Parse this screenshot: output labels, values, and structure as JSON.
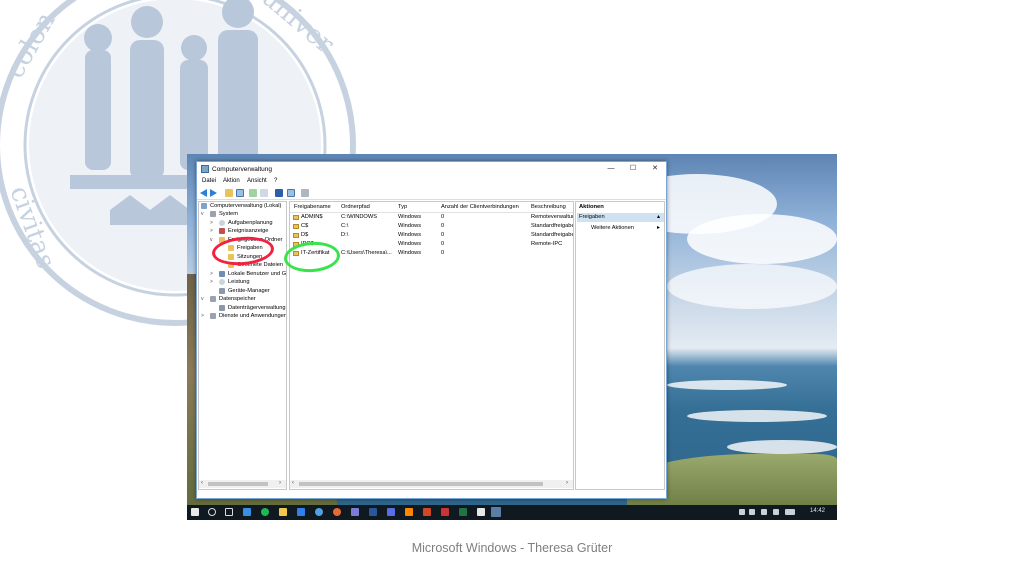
{
  "slide": {
    "caption": "Microsoft Windows - Theresa Grüter"
  },
  "window": {
    "title": "Computerverwaltung",
    "controls": {
      "minimize": "—",
      "maximize": "☐",
      "close": "✕"
    }
  },
  "menu": [
    "Datei",
    "Aktion",
    "Ansicht",
    "?"
  ],
  "tree": {
    "root": "Computerverwaltung (Lokal)",
    "system": "System",
    "aufgaben": "Aufgabenplanung",
    "ereignis": "Ereignisanzeige",
    "freigegebene": "Freigegebene Ordner",
    "freigaben": "Freigaben",
    "sitzungen": "Sitzungen",
    "geoeffnete": "Geöffnete Dateien",
    "lokale": "Lokale Benutzer und Gr",
    "leistung": "Leistung",
    "geraete": "Geräte-Manager",
    "datenspeicher": "Datenspeicher",
    "datentraeger": "Datenträgerverwaltung",
    "dienste": "Dienste und Anwendungen"
  },
  "table": {
    "columns": [
      "Freigabename",
      "Ordnerpfad",
      "Typ",
      "Anzahl der Clientverbindungen",
      "Beschreibung"
    ],
    "rows": [
      [
        "ADMIN$",
        "C:\\WINDOWS",
        "Windows",
        "0",
        "Remoteverwaltung"
      ],
      [
        "C$",
        "C:\\",
        "Windows",
        "0",
        "Standardfreigabe"
      ],
      [
        "D$",
        "D:\\",
        "Windows",
        "0",
        "Standardfreigabe"
      ],
      [
        "IPC$",
        "",
        "Windows",
        "0",
        "Remote-IPC"
      ],
      [
        "IT-Zertifikat",
        "C:\\Users\\Theresa\\...",
        "Windows",
        "0",
        ""
      ]
    ]
  },
  "actions": {
    "header": "Aktionen",
    "section": "Freigaben",
    "more": "Weitere Aktionen"
  },
  "taskbar": {
    "clock": "14:42"
  },
  "annotations": {
    "red_circle_color": "#f3203f",
    "green_circle_color": "#39e34a"
  },
  "icons": [
    "windows-start-icon",
    "search-icon",
    "task-view-icon",
    "back-arrow-icon",
    "forward-arrow-icon",
    "folder-icon",
    "help-icon"
  ]
}
